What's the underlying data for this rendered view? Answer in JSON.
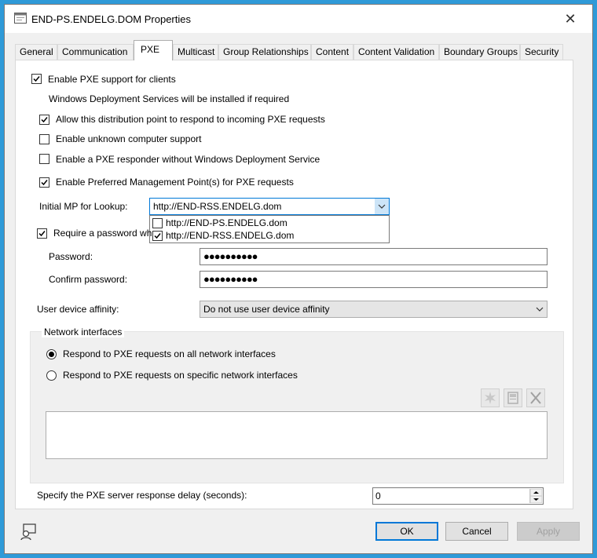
{
  "window": {
    "title": "END-PS.ENDELG.DOM Properties",
    "close_glyph": "✕"
  },
  "tabs": [
    {
      "label": "General"
    },
    {
      "label": "Communication"
    },
    {
      "label": "PXE"
    },
    {
      "label": "Multicast"
    },
    {
      "label": "Group Relationships"
    },
    {
      "label": "Content"
    },
    {
      "label": "Content Validation"
    },
    {
      "label": "Boundary Groups"
    },
    {
      "label": "Security"
    }
  ],
  "active_tab": "PXE",
  "pxe": {
    "enable_pxe": {
      "label": "Enable PXE support for clients",
      "checked": true
    },
    "wds_note": "Windows Deployment Services will be installed if required",
    "allow_respond": {
      "label": "Allow this distribution point to respond to incoming PXE requests",
      "checked": true
    },
    "unknown_computer": {
      "label": "Enable unknown computer support",
      "checked": false
    },
    "responder_without_wds": {
      "label": "Enable a PXE responder without Windows Deployment Service",
      "checked": false
    },
    "preferred_mp": {
      "label": "Enable Preferred Management Point(s) for PXE requests",
      "checked": true
    },
    "initial_mp": {
      "label": "Initial MP for Lookup:",
      "value": "http://END-RSS.ENDELG.dom",
      "options": [
        {
          "label": "http://END-PS.ENDELG.dom",
          "checked": false
        },
        {
          "label": "http://END-RSS.ENDELG.dom",
          "checked": true
        }
      ]
    },
    "require_password": {
      "label": "Require a password wh",
      "checked": true
    },
    "password": {
      "label": "Password:",
      "value": "●●●●●●●●●●"
    },
    "confirm_password": {
      "label": "Confirm password:",
      "value": "●●●●●●●●●●"
    },
    "user_device_affinity": {
      "label": "User device affinity:",
      "value": "Do not use user device affinity"
    },
    "network_interfaces": {
      "title": "Network interfaces",
      "all": {
        "label": "Respond to PXE requests on all network interfaces",
        "selected": true
      },
      "specific": {
        "label": "Respond to PXE requests on specific network interfaces",
        "selected": false
      }
    },
    "response_delay": {
      "label": "Specify the PXE server response delay (seconds):",
      "value": "0"
    }
  },
  "buttons": {
    "ok": "OK",
    "cancel": "Cancel",
    "apply": "Apply"
  },
  "icons": {
    "title": "properties-window-icon",
    "bottom": "user-help-icon",
    "toolbar": [
      "star-burst-icon",
      "properties-icon",
      "delete-x-icon"
    ]
  },
  "colors": {
    "desktop": "#2f9ad8",
    "default_button_border": "#0078d7",
    "dialog_bg": "#f0f0f0"
  }
}
